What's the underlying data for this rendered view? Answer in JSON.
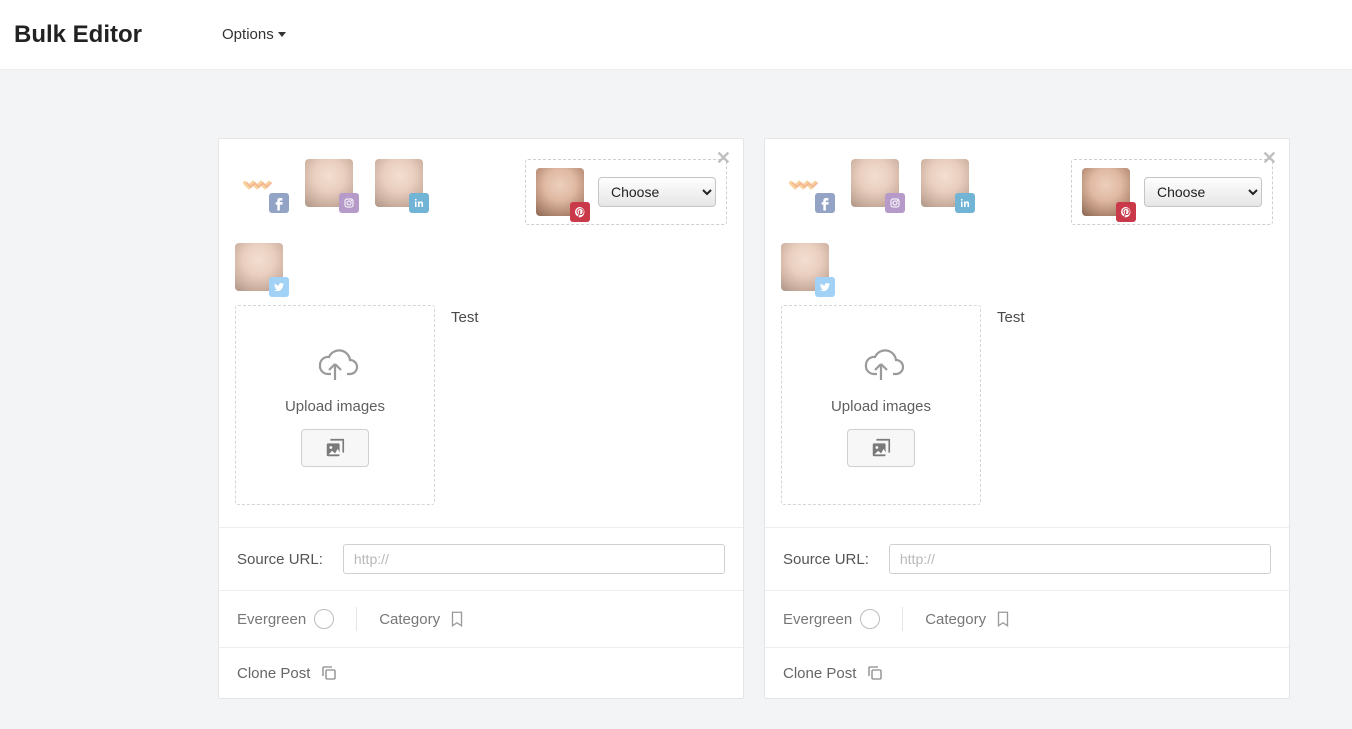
{
  "header": {
    "title": "Bulk Editor",
    "options_label": "Options"
  },
  "social_networks": [
    "facebook",
    "instagram",
    "linkedin",
    "pinterest",
    "twitter"
  ],
  "cards": [
    {
      "choose_label": "Choose",
      "upload_label": "Upload images",
      "content_text": "Test",
      "source_label": "Source URL:",
      "source_placeholder": "http://",
      "evergreen_label": "Evergreen",
      "category_label": "Category",
      "clone_label": "Clone Post"
    },
    {
      "choose_label": "Choose",
      "upload_label": "Upload images",
      "content_text": "Test",
      "source_label": "Source URL:",
      "source_placeholder": "http://",
      "evergreen_label": "Evergreen",
      "category_label": "Category",
      "clone_label": "Clone Post"
    }
  ]
}
